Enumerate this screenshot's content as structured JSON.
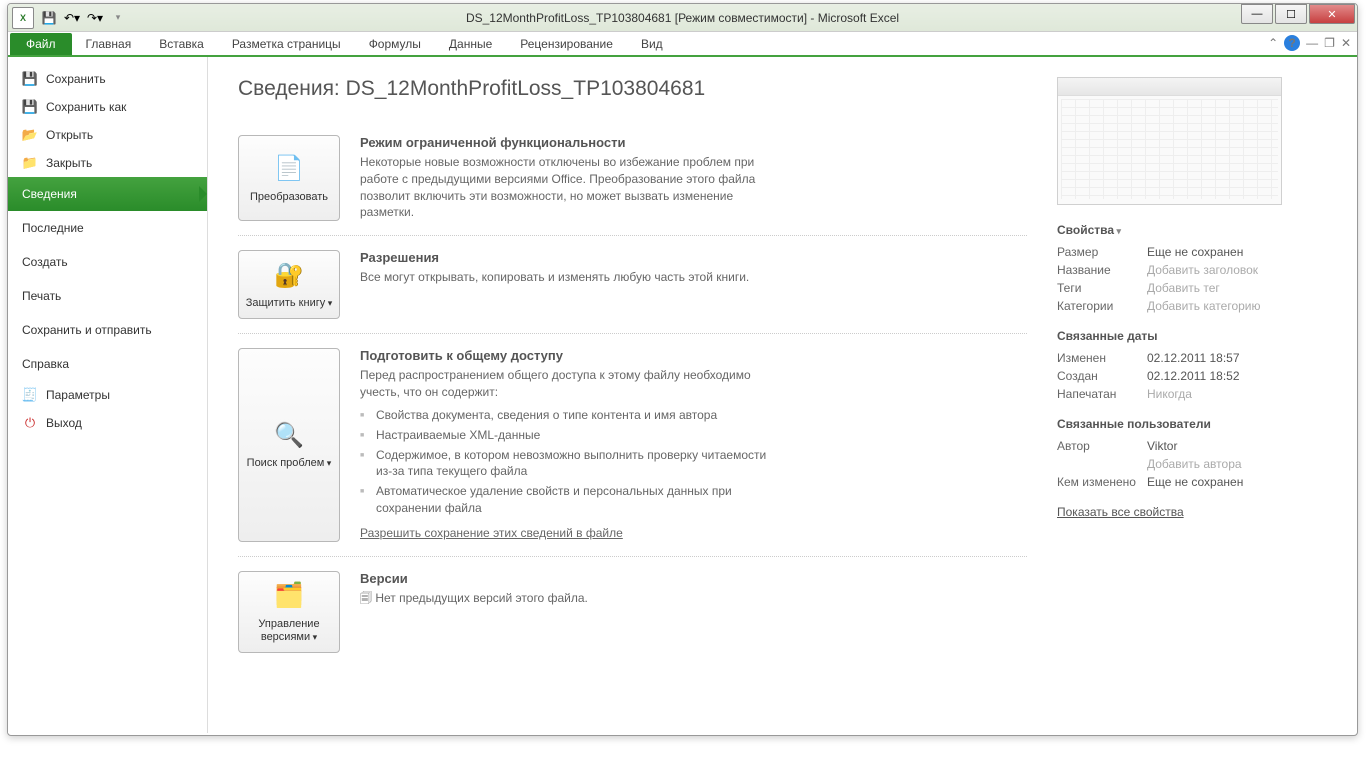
{
  "window_title": "DS_12MonthProfitLoss_TP103804681  [Режим совместимости]  -  Microsoft Excel",
  "ribbon": {
    "file": "Файл",
    "tabs": [
      "Главная",
      "Вставка",
      "Разметка страницы",
      "Формулы",
      "Данные",
      "Рецензирование",
      "Вид"
    ]
  },
  "sidebar": {
    "items": [
      {
        "icon": "save-icon",
        "label": "Сохранить"
      },
      {
        "icon": "saveas-icon",
        "label": "Сохранить как"
      },
      {
        "icon": "open-icon",
        "label": "Открыть"
      },
      {
        "icon": "close-icon",
        "label": "Закрыть"
      }
    ],
    "active": "Сведения",
    "items2": [
      "Последние",
      "Создать",
      "Печать",
      "Сохранить и отправить",
      "Справка"
    ],
    "bottom": [
      {
        "icon": "options-icon",
        "label": "Параметры"
      },
      {
        "icon": "exit-icon",
        "label": "Выход"
      }
    ]
  },
  "main": {
    "title_prefix": "Сведения: ",
    "title_doc": "DS_12MonthProfitLoss_TP103804681",
    "sections": {
      "compat": {
        "button": "Преобразовать",
        "heading": "Режим ограниченной функциональности",
        "body": "Некоторые новые возможности отключены во избежание проблем при работе с предыдущими версиями Office. Преобразование этого файла позволит включить эти возможности, но может вызвать изменение разметки."
      },
      "perm": {
        "button": "Защитить книгу",
        "heading": "Разрешения",
        "body": "Все могут открывать, копировать и изменять любую часть этой книги."
      },
      "share": {
        "button": "Поиск проблем",
        "heading": "Подготовить к общему доступу",
        "body": "Перед распространением общего доступа к этому файлу необходимо учесть, что он содержит:",
        "items": [
          "Свойства документа, сведения о типе контента и имя автора",
          "Настраиваемые XML-данные",
          "Содержимое, в котором невозможно выполнить проверку читаемости из-за типа текущего файла",
          "Автоматическое удаление свойств и персональных данных при сохранении файла"
        ],
        "link": "Разрешить сохранение этих сведений в файле"
      },
      "versions": {
        "button": "Управление версиями",
        "heading": "Версии",
        "body": "Нет предыдущих версий этого файла."
      }
    }
  },
  "right": {
    "props_title": "Свойства",
    "props": [
      {
        "label": "Размер",
        "value": "Еще не сохранен",
        "ph": false
      },
      {
        "label": "Название",
        "value": "Добавить заголовок",
        "ph": true
      },
      {
        "label": "Теги",
        "value": "Добавить тег",
        "ph": true
      },
      {
        "label": "Категории",
        "value": "Добавить категорию",
        "ph": true
      }
    ],
    "dates_title": "Связанные даты",
    "dates": [
      {
        "label": "Изменен",
        "value": "02.12.2011 18:57"
      },
      {
        "label": "Создан",
        "value": "02.12.2011 18:52"
      },
      {
        "label": "Напечатан",
        "value": "Никогда",
        "ph": true
      }
    ],
    "users_title": "Связанные пользователи",
    "author_label": "Автор",
    "author_value": "Viktor",
    "add_author": "Добавить автора",
    "modified_label": "Кем изменено",
    "modified_value": "Еще не сохранен",
    "show_all": "Показать все свойства"
  }
}
